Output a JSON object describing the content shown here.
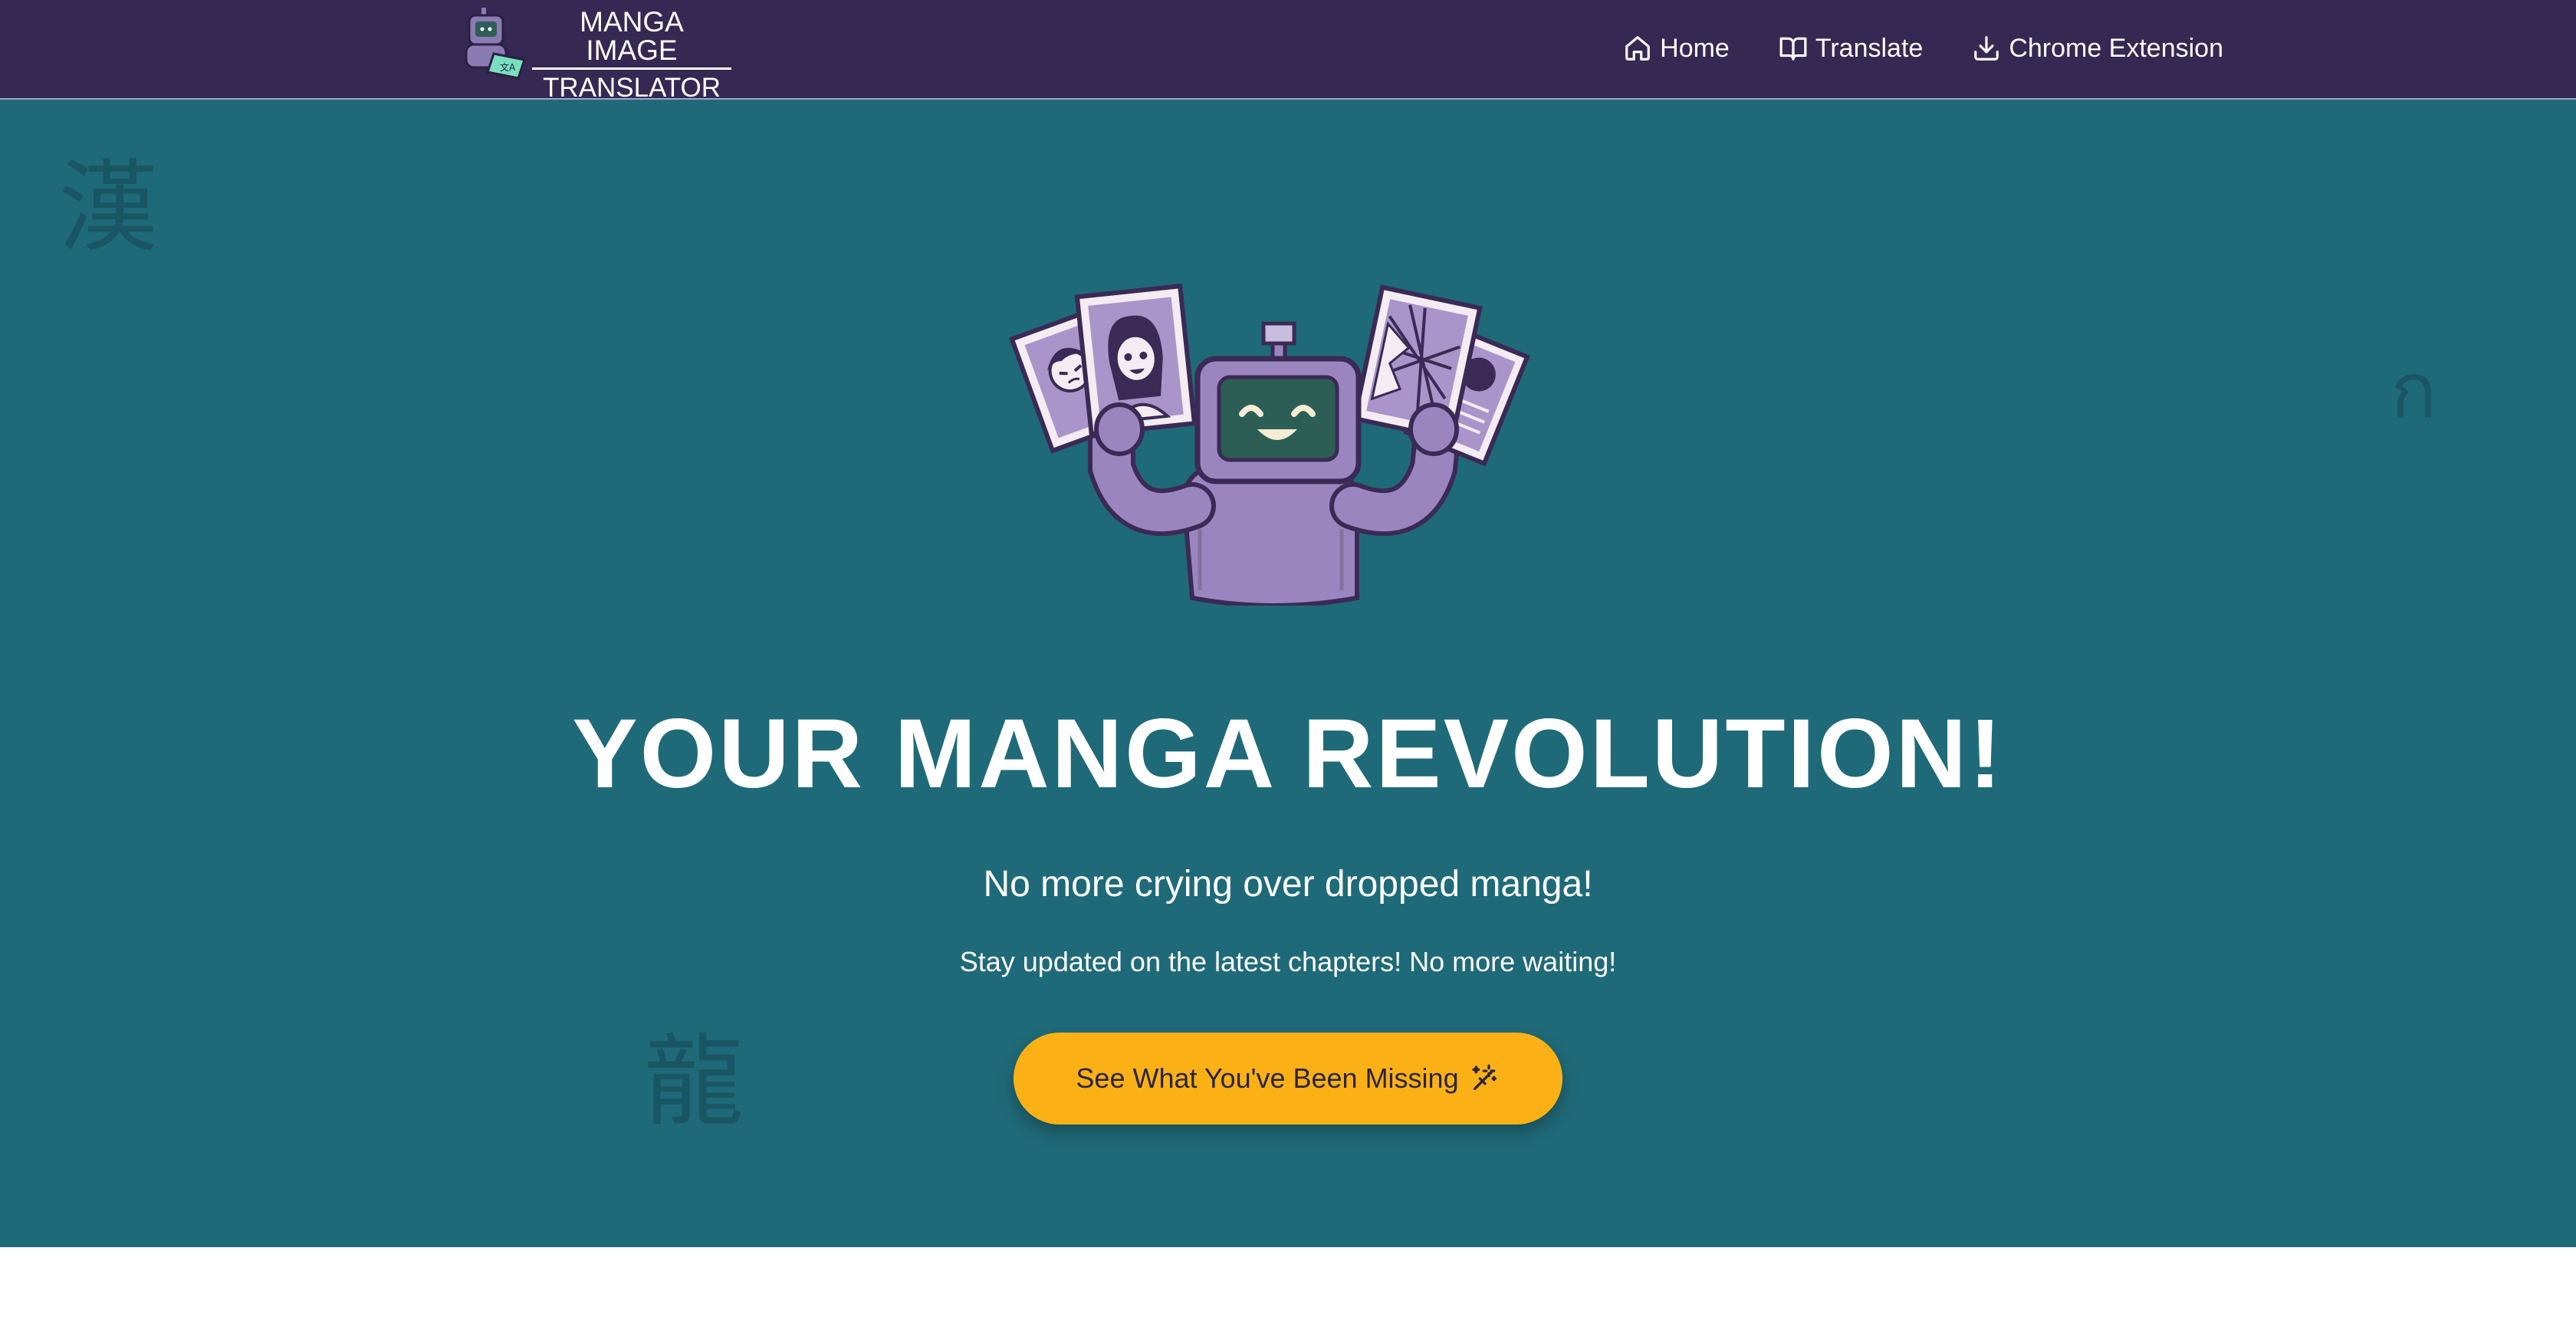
{
  "header": {
    "logo": {
      "line1": "MANGA IMAGE",
      "line2": "TRANSLATOR"
    },
    "nav": [
      {
        "label": "Home",
        "icon": "home-icon"
      },
      {
        "label": "Translate",
        "icon": "book-open-icon"
      },
      {
        "label": "Chrome Extension",
        "icon": "download-icon"
      }
    ]
  },
  "hero": {
    "background_chars": [
      "漢",
      "ก",
      "龍"
    ],
    "headline": "YOUR MANGA REVOLUTION!",
    "subhead": "No more crying over dropped manga!",
    "tagline": "Stay updated on the latest chapters! No more waiting!",
    "cta": {
      "label": "See What You've Been Missing",
      "icon": "magic-wand-icon"
    }
  },
  "colors": {
    "header_bg": "#352852",
    "hero_bg": "#1f6a78",
    "cta_bg": "#fbb116",
    "robot_purple": "#9b85bf"
  }
}
